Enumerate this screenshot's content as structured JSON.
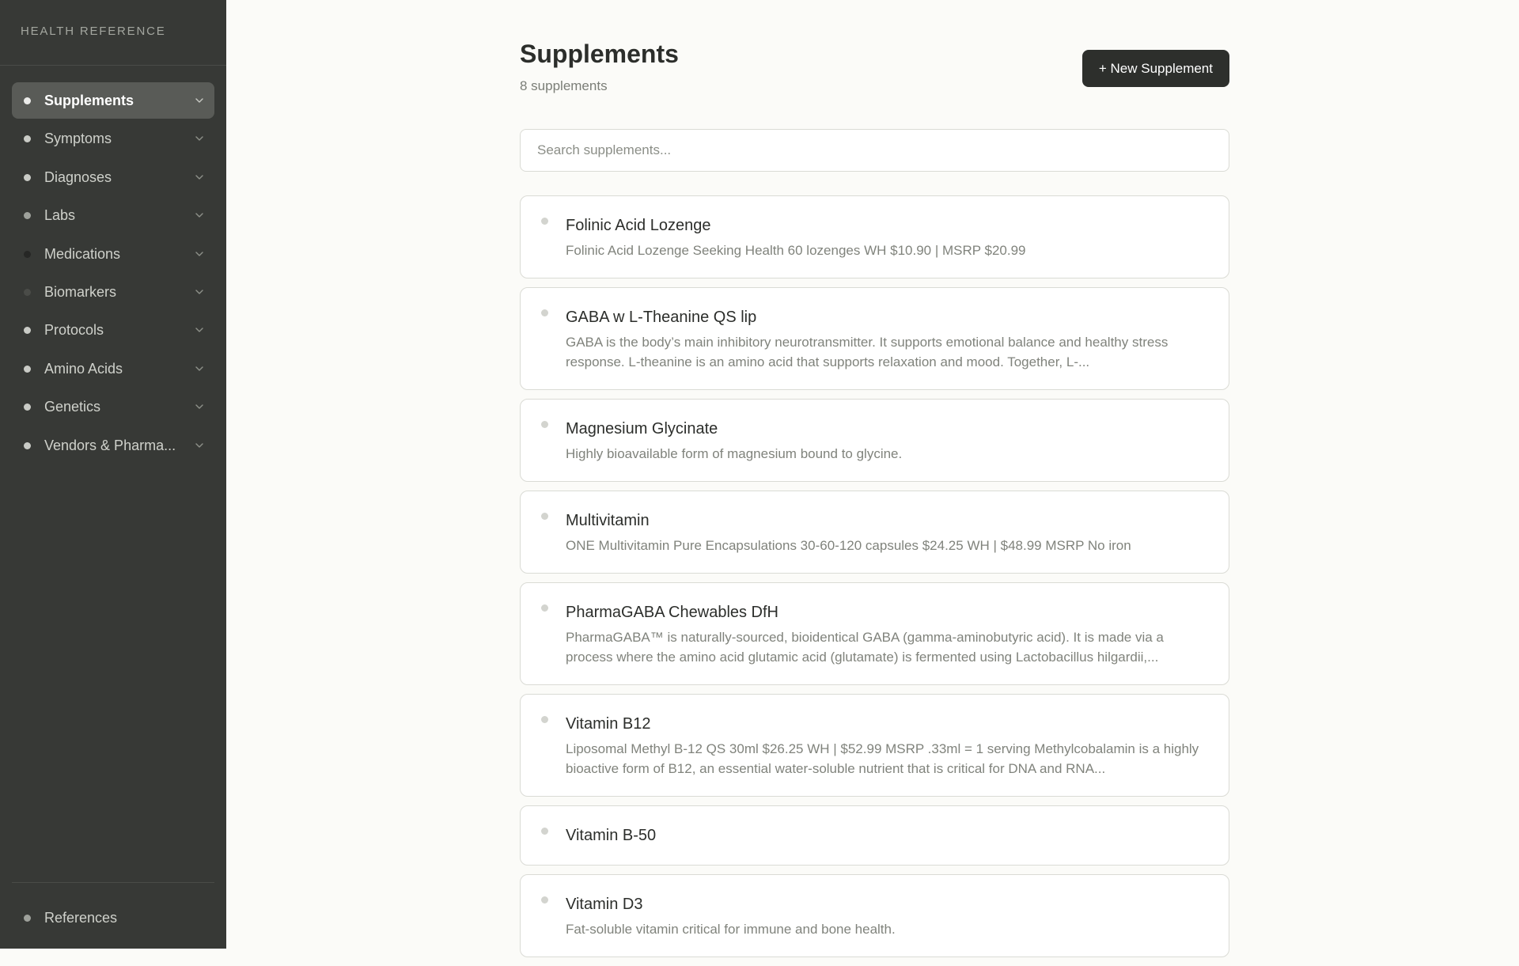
{
  "app": {
    "brand": "HEALTH REFERENCE"
  },
  "colors": {
    "sidebar_bg": "#373936",
    "sidebar_active_bg": "#595b57",
    "primary_button_bg": "#2d2f2c",
    "page_bg": "#fbfbf8"
  },
  "sidebar": {
    "items": [
      {
        "label": "Supplements",
        "active": true,
        "dot_color": "#ececea",
        "icon": "chevron-down-icon"
      },
      {
        "label": "Symptoms",
        "active": false,
        "dot_color": "#c9cbc6",
        "icon": "chevron-down-icon"
      },
      {
        "label": "Diagnoses",
        "active": false,
        "dot_color": "#c9cbc6",
        "icon": "chevron-down-icon"
      },
      {
        "label": "Labs",
        "active": false,
        "dot_color": "#9ea19b",
        "icon": "chevron-down-icon"
      },
      {
        "label": "Medications",
        "active": false,
        "dot_color": "#262725",
        "icon": "chevron-down-icon"
      },
      {
        "label": "Biomarkers",
        "active": false,
        "dot_color": "#4a4c48",
        "icon": "chevron-down-icon"
      },
      {
        "label": "Protocols",
        "active": false,
        "dot_color": "#c9cbc6",
        "icon": "chevron-down-icon"
      },
      {
        "label": "Amino Acids",
        "active": false,
        "dot_color": "#c9cbc6",
        "icon": "chevron-down-icon"
      },
      {
        "label": "Genetics",
        "active": false,
        "dot_color": "#c9cbc6",
        "icon": "chevron-down-icon"
      },
      {
        "label": "Vendors & Pharma...",
        "active": false,
        "dot_color": "#c9cbc6",
        "icon": "chevron-down-icon"
      }
    ],
    "footer_item": {
      "label": "References",
      "dot_color": "#9ea19b"
    }
  },
  "header": {
    "title": "Supplements",
    "count_text": "8 supplements",
    "new_button_label": "+ New Supplement"
  },
  "search": {
    "placeholder": "Search supplements...",
    "value": ""
  },
  "supplements": [
    {
      "name": "Folinic Acid Lozenge",
      "description": "Folinic Acid Lozenge Seeking Health 60 lozenges WH $10.90 | MSRP $20.99"
    },
    {
      "name": "GABA w L-Theanine QS lip",
      "description": "GABA is the body’s main inhibitory neurotransmitter. It supports emotional balance and healthy stress response. L-theanine is an amino acid that supports relaxation and mood. Together, L-..."
    },
    {
      "name": "Magnesium Glycinate",
      "description": "Highly bioavailable form of magnesium bound to glycine."
    },
    {
      "name": "Multivitamin",
      "description": "ONE Multivitamin Pure Encapsulations 30-60-120 capsules $24.25 WH | $48.99 MSRP No iron"
    },
    {
      "name": "PharmaGABA Chewables DfH",
      "description": "PharmaGABA™ is naturally-sourced, bioidentical GABA (gamma-aminobutyric acid). It is made via a process where the amino acid glutamic acid (glutamate) is fermented using Lactobacillus hilgardii,..."
    },
    {
      "name": "Vitamin B12",
      "description": "Liposomal Methyl B-12 QS 30ml $26.25 WH | $52.99 MSRP .33ml = 1 serving Methylcobalamin is a highly bioactive form of B12, an essential water-soluble nutrient that is critical for DNA and RNA..."
    },
    {
      "name": "Vitamin B-50",
      "description": ""
    },
    {
      "name": "Vitamin D3",
      "description": "Fat-soluble vitamin critical for immune and bone health."
    }
  ]
}
